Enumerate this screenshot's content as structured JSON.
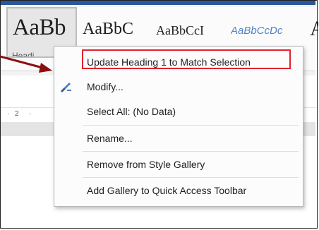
{
  "ribbon": {
    "style_gallery": [
      {
        "sample": "AaBb",
        "name": "Headi"
      },
      {
        "sample": "AaBbC"
      },
      {
        "sample": "AaBbCcI"
      },
      {
        "sample": "AaBbCcDc"
      },
      {
        "sample": "A"
      }
    ]
  },
  "ruler": {
    "marks": [
      "·",
      "2",
      "·"
    ]
  },
  "context_menu": {
    "items": [
      {
        "label": "Update Heading 1 to Match Selection"
      },
      {
        "label": "Modify...",
        "icon": "brush-icon"
      },
      {
        "label": "Select All: (No Data)"
      },
      {
        "label": "Rename..."
      },
      {
        "label": "Remove from Style Gallery"
      },
      {
        "label": "Add Gallery to Quick Access Toolbar"
      }
    ]
  },
  "colors": {
    "highlight_box": "#e0232f",
    "arrow": "#8b0f0f",
    "accent_italic": "#4e83c4"
  }
}
